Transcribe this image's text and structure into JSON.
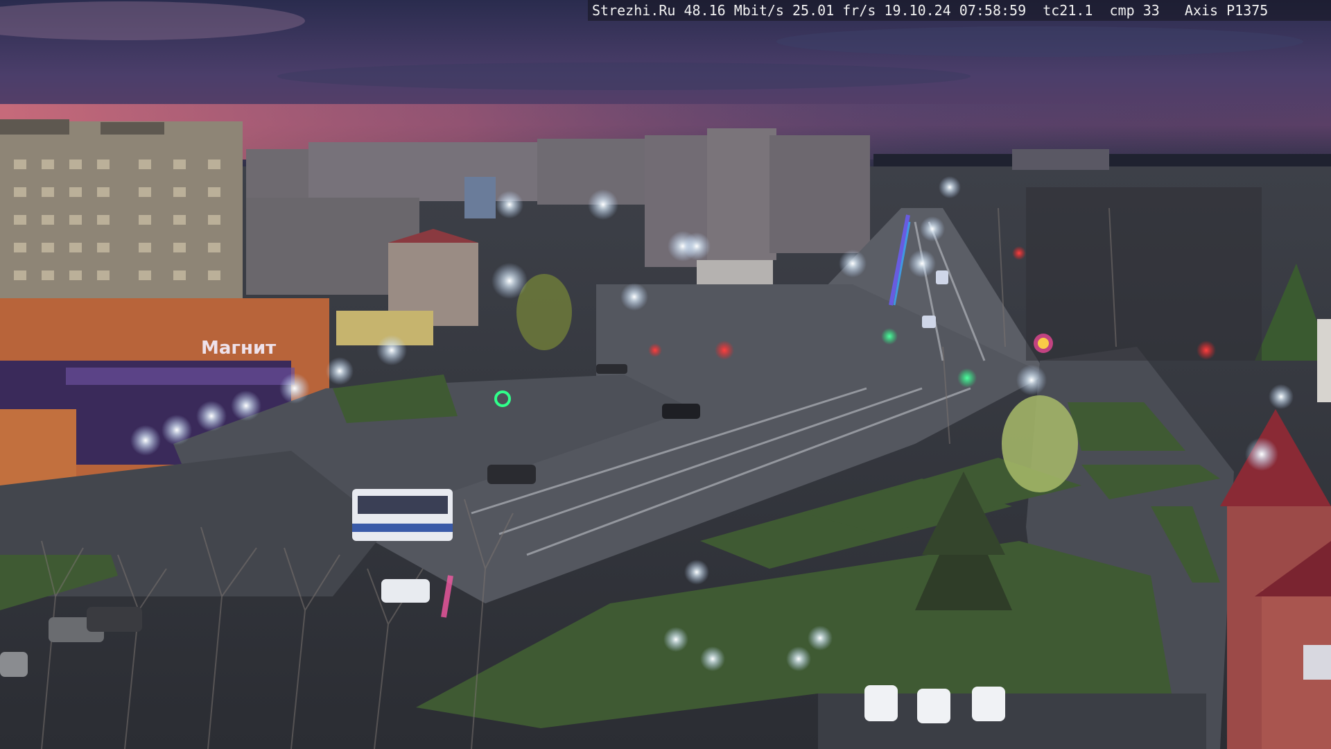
{
  "camera_overlay": {
    "text": "Strezhi.Ru 48.16 Mbit/s 25.01 fr/s 19.10.24 07:58:59  tc21.1  cmp 33   Axis P1375"
  },
  "shop_sign": {
    "text": "Магнит"
  },
  "colors": {
    "sky_top": "#2b2f52",
    "sky_mid": "#4a3f6b",
    "sky_glow": "#c96a7a",
    "road": "#5a5d66",
    "grass": "#3f5a33",
    "street_light": "#e8f4ff",
    "traffic_red": "#ff2a2a",
    "traffic_green": "#2aff8a",
    "roof_red": "#8a2a35"
  }
}
